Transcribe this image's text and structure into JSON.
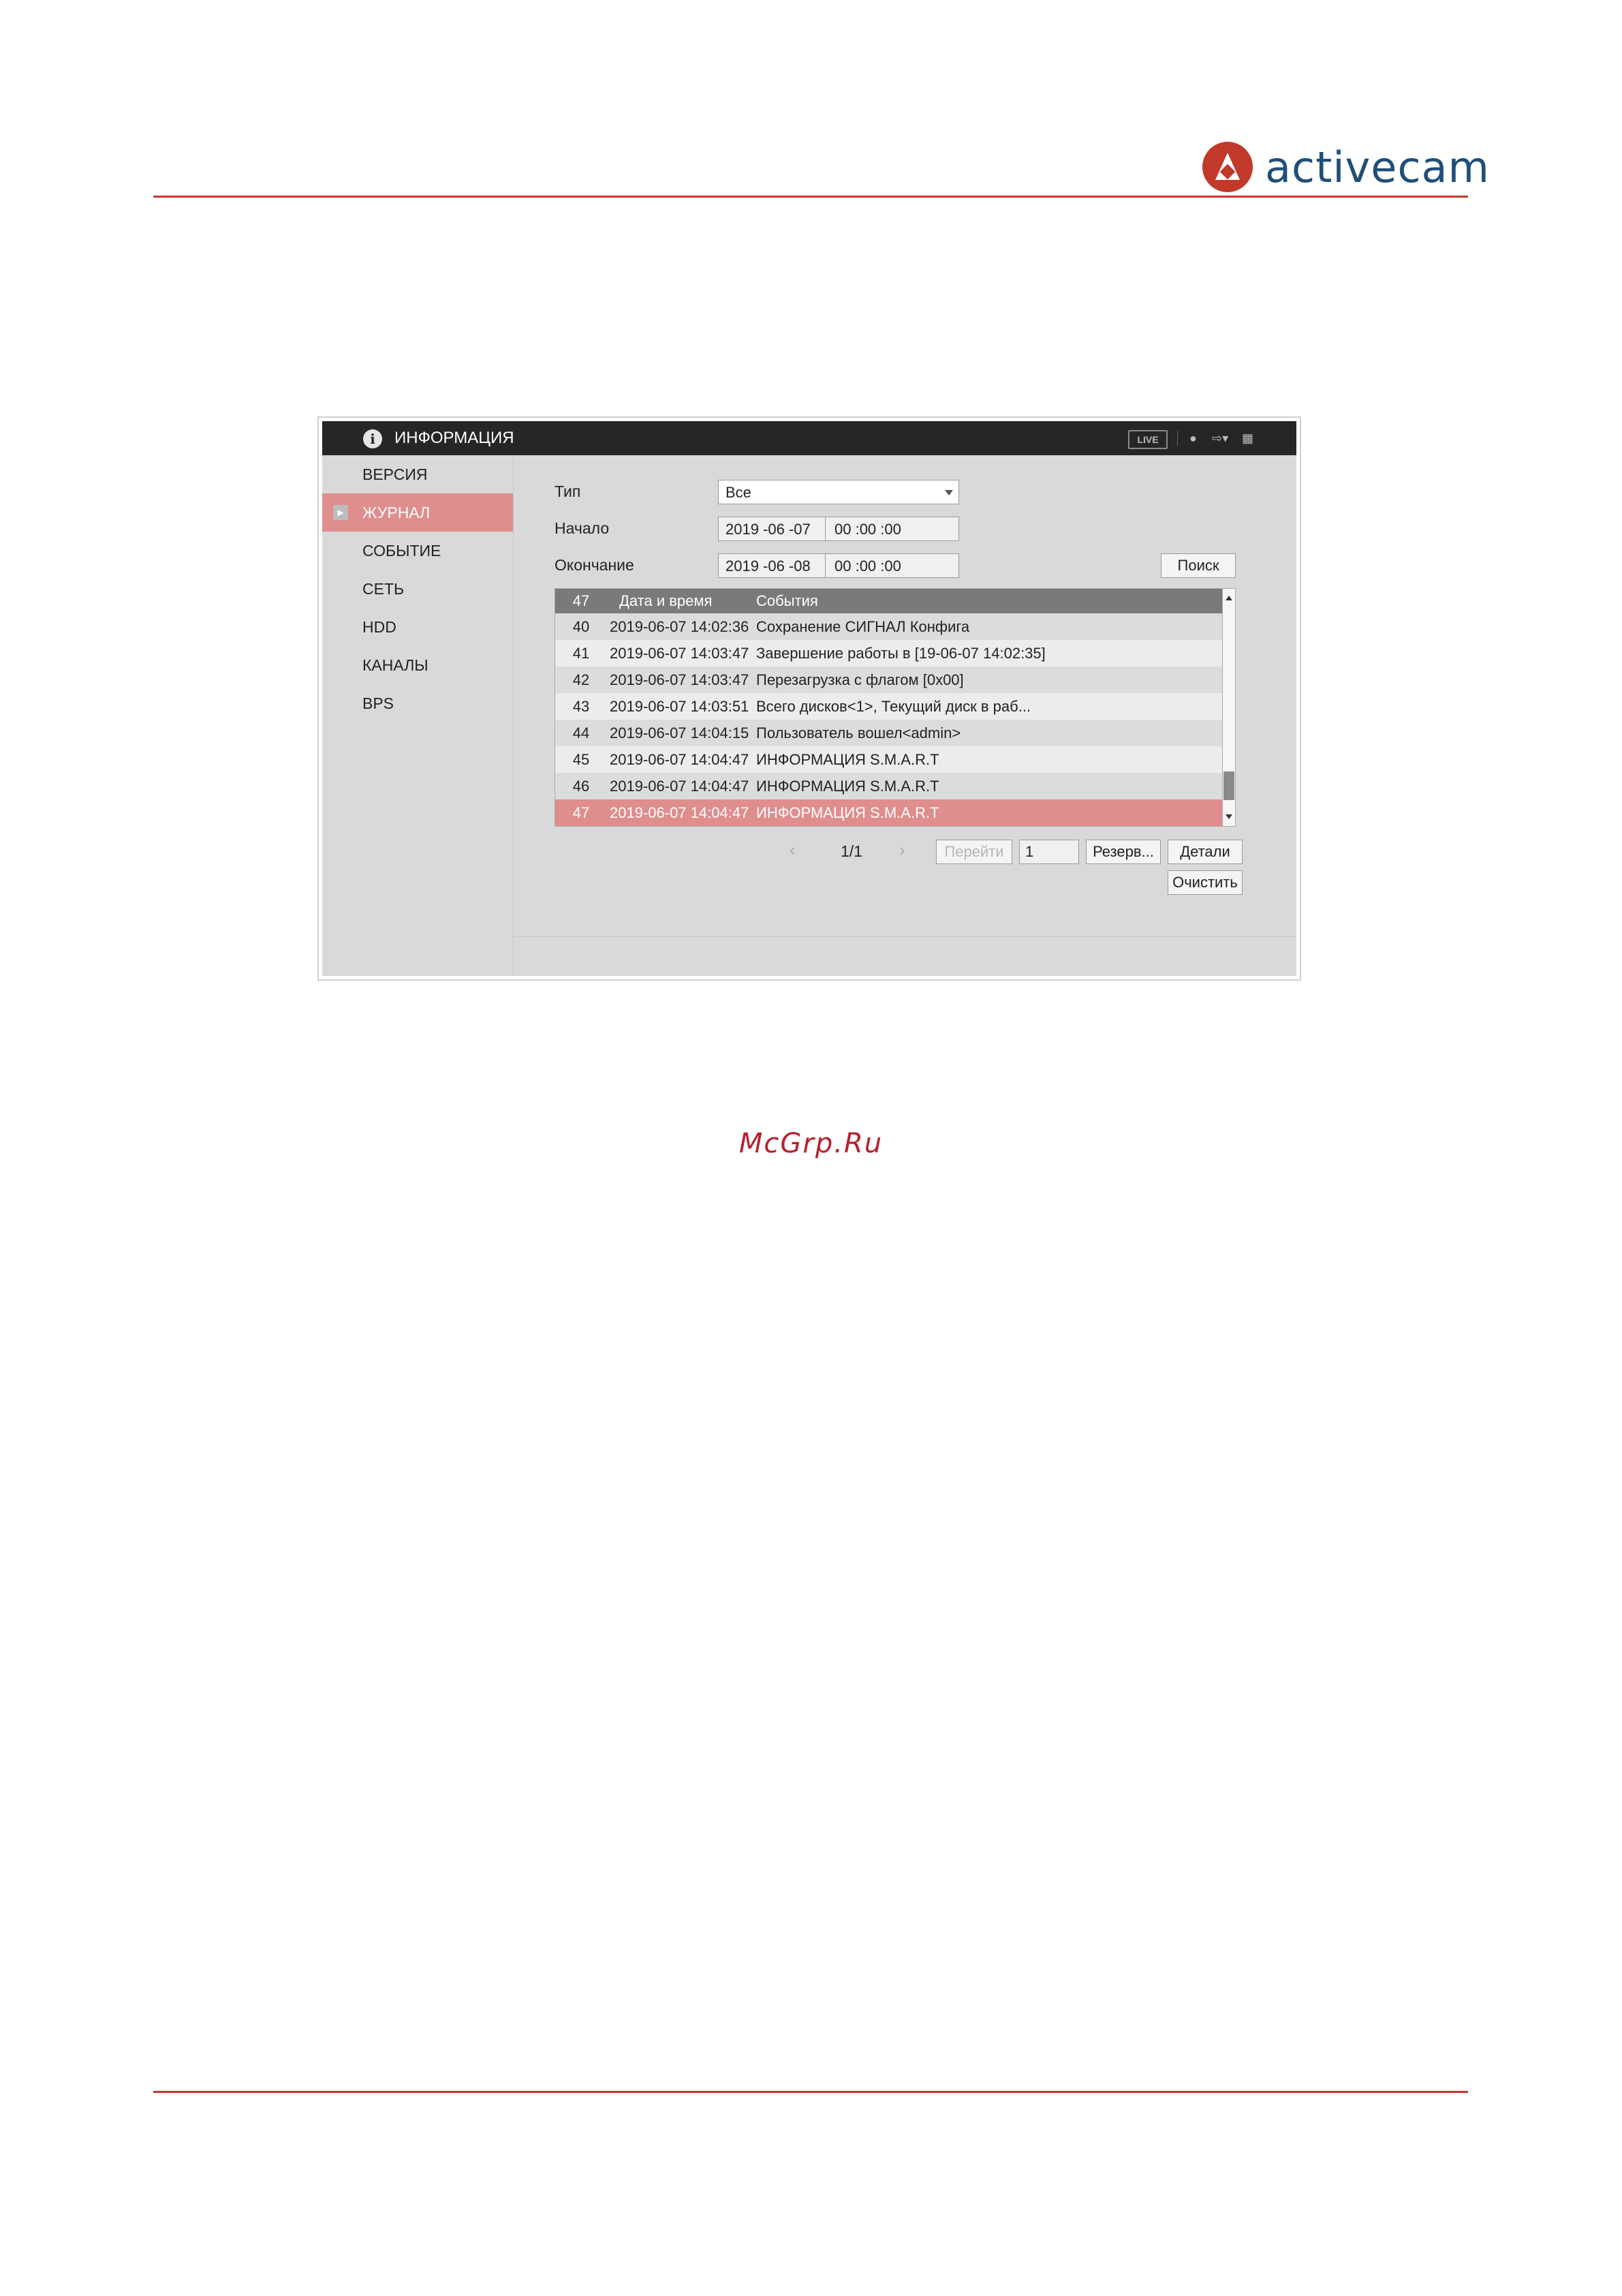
{
  "brand": {
    "name": "activecam"
  },
  "watermark": "McGrp.Ru",
  "app": {
    "title": "ИНФОРМАЦИЯ",
    "live_label": "LIVE",
    "icons": [
      "info-icon",
      "user-icon",
      "logout-icon",
      "menu-grid-icon"
    ]
  },
  "sidebar": {
    "items": [
      {
        "label": "ВЕРСИЯ"
      },
      {
        "label": "ЖУРНАЛ",
        "active": true
      },
      {
        "label": "СОБЫТИЕ"
      },
      {
        "label": "СЕТЬ"
      },
      {
        "label": "HDD"
      },
      {
        "label": "КАНАЛЫ"
      },
      {
        "label": "BPS"
      }
    ]
  },
  "form": {
    "type_label": "Тип",
    "type_value": "Все",
    "start_label": "Начало",
    "start_date": "2019 -06 -07",
    "start_time": "00 :00 :00",
    "end_label": "Окончание",
    "end_date": "2019 -06 -08",
    "end_time": "00 :00 :00",
    "search_button": "Поиск"
  },
  "table": {
    "headers": {
      "count": "47",
      "datetime": "Дата и время",
      "events": "События"
    },
    "rows": [
      {
        "num": "40",
        "datetime": "2019-06-07 14:02:36",
        "event": "Сохранение СИГНАЛ Конфига"
      },
      {
        "num": "41",
        "datetime": "2019-06-07 14:03:47",
        "event": "Завершение работы в [19-06-07 14:02:35]"
      },
      {
        "num": "42",
        "datetime": "2019-06-07 14:03:47",
        "event": "Перезагрузка с флагом [0x00]"
      },
      {
        "num": "43",
        "datetime": "2019-06-07 14:03:51",
        "event": "Всего дисков<1>, Текущий диск в раб..."
      },
      {
        "num": "44",
        "datetime": "2019-06-07 14:04:15",
        "event": "Пользователь вошел<admin>"
      },
      {
        "num": "45",
        "datetime": "2019-06-07 14:04:47",
        "event": "ИНФОРМАЦИЯ S.M.A.R.T"
      },
      {
        "num": "46",
        "datetime": "2019-06-07 14:04:47",
        "event": "ИНФОРМАЦИЯ S.M.A.R.T"
      },
      {
        "num": "47",
        "datetime": "2019-06-07 14:04:47",
        "event": "ИНФОРМАЦИЯ S.M.A.R.T",
        "selected": true
      }
    ]
  },
  "pager": {
    "prev_symbol": "‹",
    "next_symbol": "›",
    "page_text": "1/1",
    "goto_button": "Перейти",
    "page_input": "1",
    "backup_button": "Резерв...",
    "details_button": "Детали",
    "clear_button": "Очистить"
  },
  "colors": {
    "accent_red": "#c0392b",
    "brand_blue": "#1f4e79",
    "selection": "#e08d8d",
    "titlebar": "#262626"
  }
}
